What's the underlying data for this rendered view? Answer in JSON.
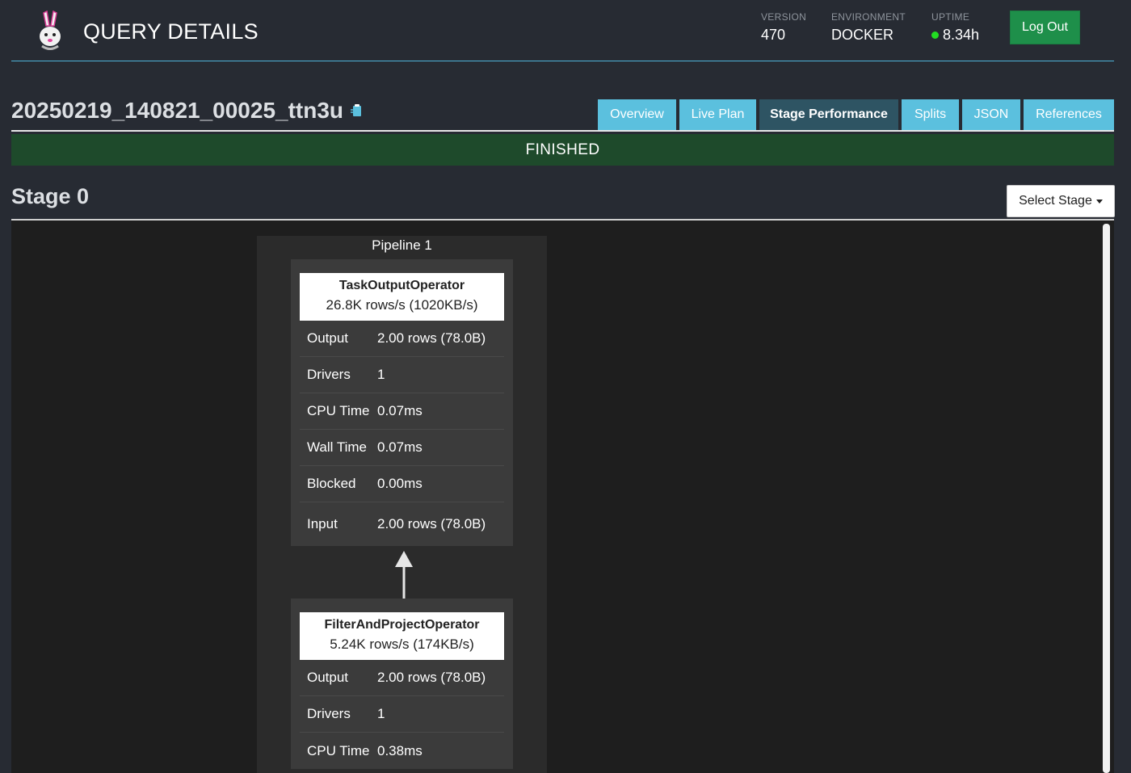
{
  "header": {
    "title": "QUERY DETAILS",
    "version_label": "VERSION",
    "version": "470",
    "environment_label": "ENVIRONMENT",
    "environment": "DOCKER",
    "uptime_label": "UPTIME",
    "uptime": "8.34h",
    "logout_label": "Log Out"
  },
  "query": {
    "id": "20250219_140821_00025_ttn3u",
    "status": "FINISHED"
  },
  "tabs": [
    {
      "label": "Overview",
      "active": false
    },
    {
      "label": "Live Plan",
      "active": false
    },
    {
      "label": "Stage Performance",
      "active": true
    },
    {
      "label": "Splits",
      "active": false
    },
    {
      "label": "JSON",
      "active": false
    },
    {
      "label": "References",
      "active": false
    }
  ],
  "stage": {
    "title": "Stage 0",
    "select_label": "Select Stage"
  },
  "pipeline": {
    "label": "Pipeline 1",
    "operators": [
      {
        "name": "TaskOutputOperator",
        "rate": "26.8K rows/s (1020KB/s)",
        "stats": [
          {
            "key": "Output",
            "value": "2.00 rows (78.0B)"
          },
          {
            "key": "Drivers",
            "value": "1"
          },
          {
            "key": "CPU Time",
            "value": "0.07ms"
          },
          {
            "key": "Wall Time",
            "value": "0.07ms"
          },
          {
            "key": "Blocked",
            "value": "0.00ms"
          },
          {
            "key": "Input",
            "value": "2.00 rows (78.0B)"
          }
        ]
      },
      {
        "name": "FilterAndProjectOperator",
        "rate": "5.24K rows/s (174KB/s)",
        "stats": [
          {
            "key": "Output",
            "value": "2.00 rows (78.0B)"
          },
          {
            "key": "Drivers",
            "value": "1"
          },
          {
            "key": "CPU Time",
            "value": "0.38ms"
          }
        ]
      }
    ]
  },
  "colors": {
    "accent": "#5bc0de",
    "active_tab": "#2e5463",
    "finished": "#1e4a2b",
    "logout": "#1e8f4a",
    "uptime_dot": "#22dd22"
  }
}
